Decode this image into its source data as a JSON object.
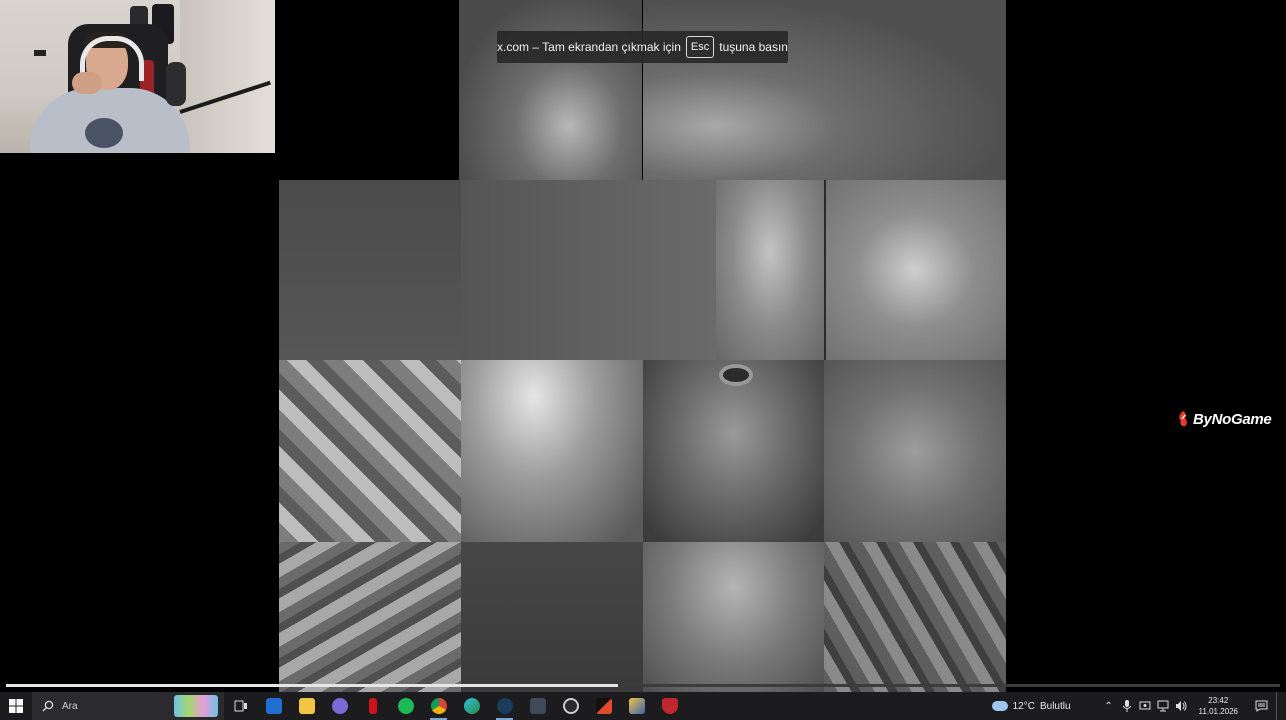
{
  "notice": {
    "prefix": "x.com – Tam ekrandan çıkmak için",
    "key": "Esc",
    "suffix": "tuşuna basın"
  },
  "brand": {
    "name": "ByNoGame"
  },
  "video": {
    "progress_percent": 48
  },
  "taskbar": {
    "search_placeholder": "Ara",
    "apps": [
      "task-view",
      "outlook",
      "file-explorer",
      "discord",
      "red-app",
      "spotify",
      "chrome",
      "edge",
      "steam",
      "game-launcher",
      "racing-app",
      "media-app",
      "winrar",
      "antivirus"
    ],
    "weather": {
      "temp": "12°C",
      "condition": "Bulutlu"
    },
    "clock": {
      "time": "23:42",
      "date": "11.01.2026"
    }
  }
}
